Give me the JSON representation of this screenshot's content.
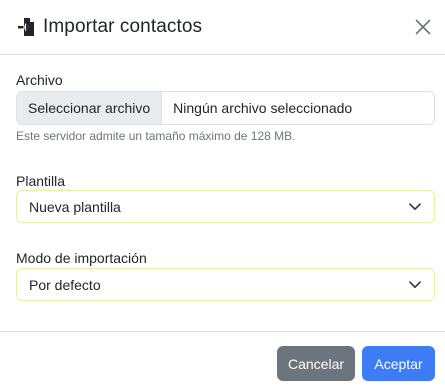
{
  "header": {
    "title": "Importar contactos",
    "icon": "file-import-icon",
    "close_icon": "close-icon"
  },
  "file_section": {
    "label": "Archivo",
    "button_label": "Seleccionar archivo",
    "status": "Ningún archivo seleccionado",
    "help_text": "Este servidor admite un tamaño máximo de 128 MB."
  },
  "template_section": {
    "label": "Plantilla",
    "selected": "Nueva plantilla"
  },
  "import_mode_section": {
    "label": "Modo de importación",
    "selected": "Por defecto"
  },
  "footer": {
    "cancel_label": "Cancelar",
    "accept_label": "Aceptar"
  },
  "colors": {
    "primary": "#3d7cf5",
    "secondary": "#6c757d",
    "select_border": "#e6f0a3"
  }
}
